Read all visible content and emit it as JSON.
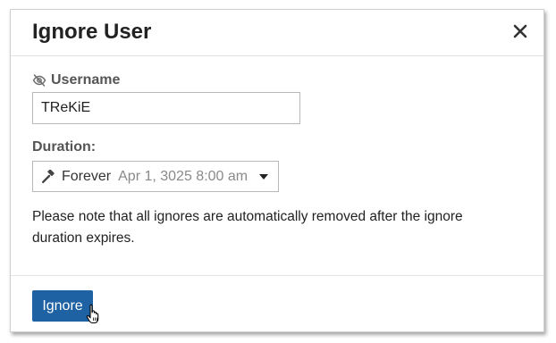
{
  "dialog": {
    "title": "Ignore User",
    "close_icon": "close-icon"
  },
  "username": {
    "label": "Username",
    "icon": "eye-slash-icon",
    "value": "TReKiE"
  },
  "duration": {
    "label": "Duration:",
    "icon": "gavel-icon",
    "selected": "Forever",
    "date": "Apr 1, 3025 8:00 am"
  },
  "note": "Please note that all ignores are automatically removed after the ignore duration expires.",
  "footer": {
    "ignore_label": "Ignore"
  },
  "colors": {
    "primary_button": "#1e62a4",
    "label_text": "#555555",
    "muted_text": "#8a8a8a"
  }
}
